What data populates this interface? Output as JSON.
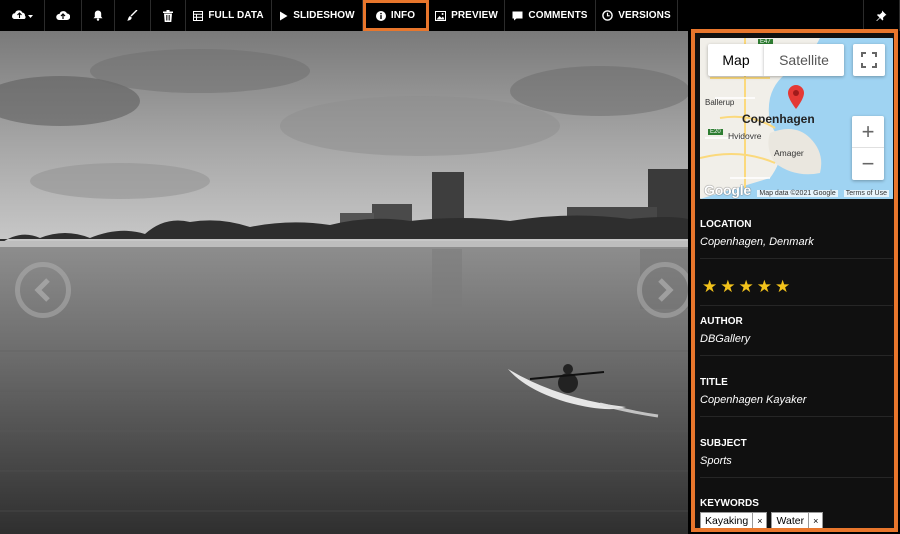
{
  "toolbar": {
    "buttons": [
      {
        "icon": "cloud-dropdown-icon"
      },
      {
        "icon": "cloud-upload-icon"
      },
      {
        "icon": "bell-icon"
      },
      {
        "icon": "brush-icon"
      },
      {
        "icon": "trash-icon"
      },
      {
        "icon": "table-icon",
        "label": "FULL DATA"
      },
      {
        "icon": "play-icon",
        "label": "SLIDESHOW"
      },
      {
        "icon": "info-icon",
        "label": "INFO",
        "active": true
      },
      {
        "icon": "image-icon",
        "label": "PREVIEW"
      },
      {
        "icon": "comment-icon",
        "label": "COMMENTS"
      },
      {
        "icon": "clock-icon",
        "label": "VERSIONS"
      },
      {
        "icon": "pin-icon"
      }
    ],
    "accent_color": "#e8762c"
  },
  "map": {
    "tab_map": "Map",
    "tab_satellite": "Satellite",
    "zoom_in": "+",
    "zoom_out": "−",
    "city_label": "Copenhagen",
    "labels": [
      "Ballerup",
      "Hvidovre",
      "Amager",
      "E47",
      "E20"
    ],
    "attribution": "Map data ©2021 Google",
    "terms": "Terms of Use",
    "logo": "Google",
    "marker_color": "#e53935"
  },
  "info": {
    "location_label": "LOCATION",
    "location_value": "Copenhagen, Denmark",
    "rating": 5,
    "rating_max": 5,
    "author_label": "AUTHOR",
    "author_value": "DBGallery",
    "title_label": "TITLE",
    "title_value": "Copenhagen Kayaker",
    "subject_label": "SUBJECT",
    "subject_value": "Sports",
    "keywords_label": "KEYWORDS",
    "keywords": [
      "Kayaking",
      "Water"
    ],
    "remove_symbol": "×"
  }
}
